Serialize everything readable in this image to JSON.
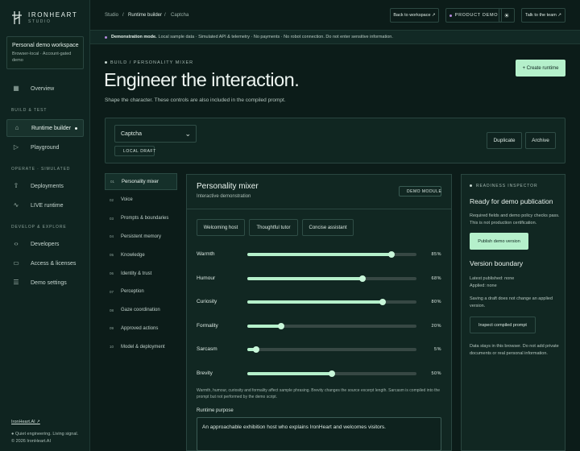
{
  "brand": {
    "name": "IRONHEART",
    "sub": "STUDIO"
  },
  "workspace": {
    "title": "Personal demo workspace",
    "sub": "Browser-local · Account-gated demo"
  },
  "sidebar": {
    "overview": "Overview",
    "section_build": "BUILD & TEST",
    "runtime_builder": "Runtime builder",
    "playground": "Playground",
    "section_operate": "OPERATE · SIMULATED",
    "deployments": "Deployments",
    "live_runtime": "LIVE runtime",
    "section_develop": "DEVELOP & EXPLORE",
    "developers": "Developers",
    "access": "Access & licenses",
    "demo_settings": "Demo settings",
    "footer_link": "IronHeart.AI ↗",
    "footer_tag": "● Quiet engineering. Living signal.",
    "footer_copy": "© 2026 IronHeart.AI"
  },
  "topbar": {
    "crumb_studio": "Studio",
    "sep": "/",
    "crumb_builder": "Runtime builder",
    "crumb_captcha": "Captcha",
    "back": "Back to workspace ↗",
    "product_demo": "PRODUCT DEMO",
    "talk": "Talk to the team ↗",
    "theme_icon": "☀"
  },
  "notice": {
    "bold": "Demonstration mode.",
    "text": "Local sample data · Simulated API & telemetry · No payments · No robot connection. Do not enter sensitive information."
  },
  "header": {
    "eyebrow": "BUILD / PERSONALITY MIXER",
    "title": "Engineer the interaction.",
    "subtitle": "Shape the character. These controls are also included in the compiled prompt.",
    "create": "+ Create runtime"
  },
  "runtime": {
    "selected": "Captcha",
    "badge": "LOCAL DRAFT",
    "duplicate": "Duplicate",
    "archive": "Archive"
  },
  "steps": [
    {
      "num": "01",
      "label": "Personality mixer"
    },
    {
      "num": "02",
      "label": "Voice"
    },
    {
      "num": "03",
      "label": "Prompts & boundaries"
    },
    {
      "num": "04",
      "label": "Persistent memory"
    },
    {
      "num": "05",
      "label": "Knowledge"
    },
    {
      "num": "06",
      "label": "Identity & trust"
    },
    {
      "num": "07",
      "label": "Perception"
    },
    {
      "num": "08",
      "label": "Gaze coordination"
    },
    {
      "num": "09",
      "label": "Approved actions"
    },
    {
      "num": "10",
      "label": "Model & deployment"
    }
  ],
  "mixer": {
    "title": "Personality mixer",
    "subtitle": "Interactive demonstration",
    "badge": "DEMO MODULE",
    "presets": [
      "Welcoming host",
      "Thoughtful tutor",
      "Concise assistant"
    ],
    "sliders": [
      {
        "label": "Warmth",
        "value": 85,
        "display": "85%"
      },
      {
        "label": "Humour",
        "value": 68,
        "display": "68%"
      },
      {
        "label": "Curiosity",
        "value": 80,
        "display": "80%"
      },
      {
        "label": "Formality",
        "value": 20,
        "display": "20%"
      },
      {
        "label": "Sarcasm",
        "value": 5,
        "display": "5%"
      },
      {
        "label": "Brevity",
        "value": 50,
        "display": "50%"
      }
    ],
    "note": "Warmth, humour, curiosity and formality affect sample phrasing. Brevity changes the source excerpt length. Sarcasm is compiled into the prompt but not performed by the demo script.",
    "purpose_label": "Runtime purpose",
    "purpose_value": "An approachable exhibition host who explains IronHeart and welcomes visitors."
  },
  "inspector": {
    "eyebrow": "READINESS INSPECTOR",
    "title": "Ready for demo publication",
    "text1": "Required fields and demo policy checks pass. This is not production certification.",
    "publish": "Publish demo version",
    "boundary_title": "Version boundary",
    "latest": "Latest published: none",
    "applied": "Applied: none",
    "saving_note": "Saving a draft does not change an applied version.",
    "inspect": "Inspect compiled prompt",
    "data_note": "Data stays in this browser. Do not add private documents or real personal information."
  }
}
